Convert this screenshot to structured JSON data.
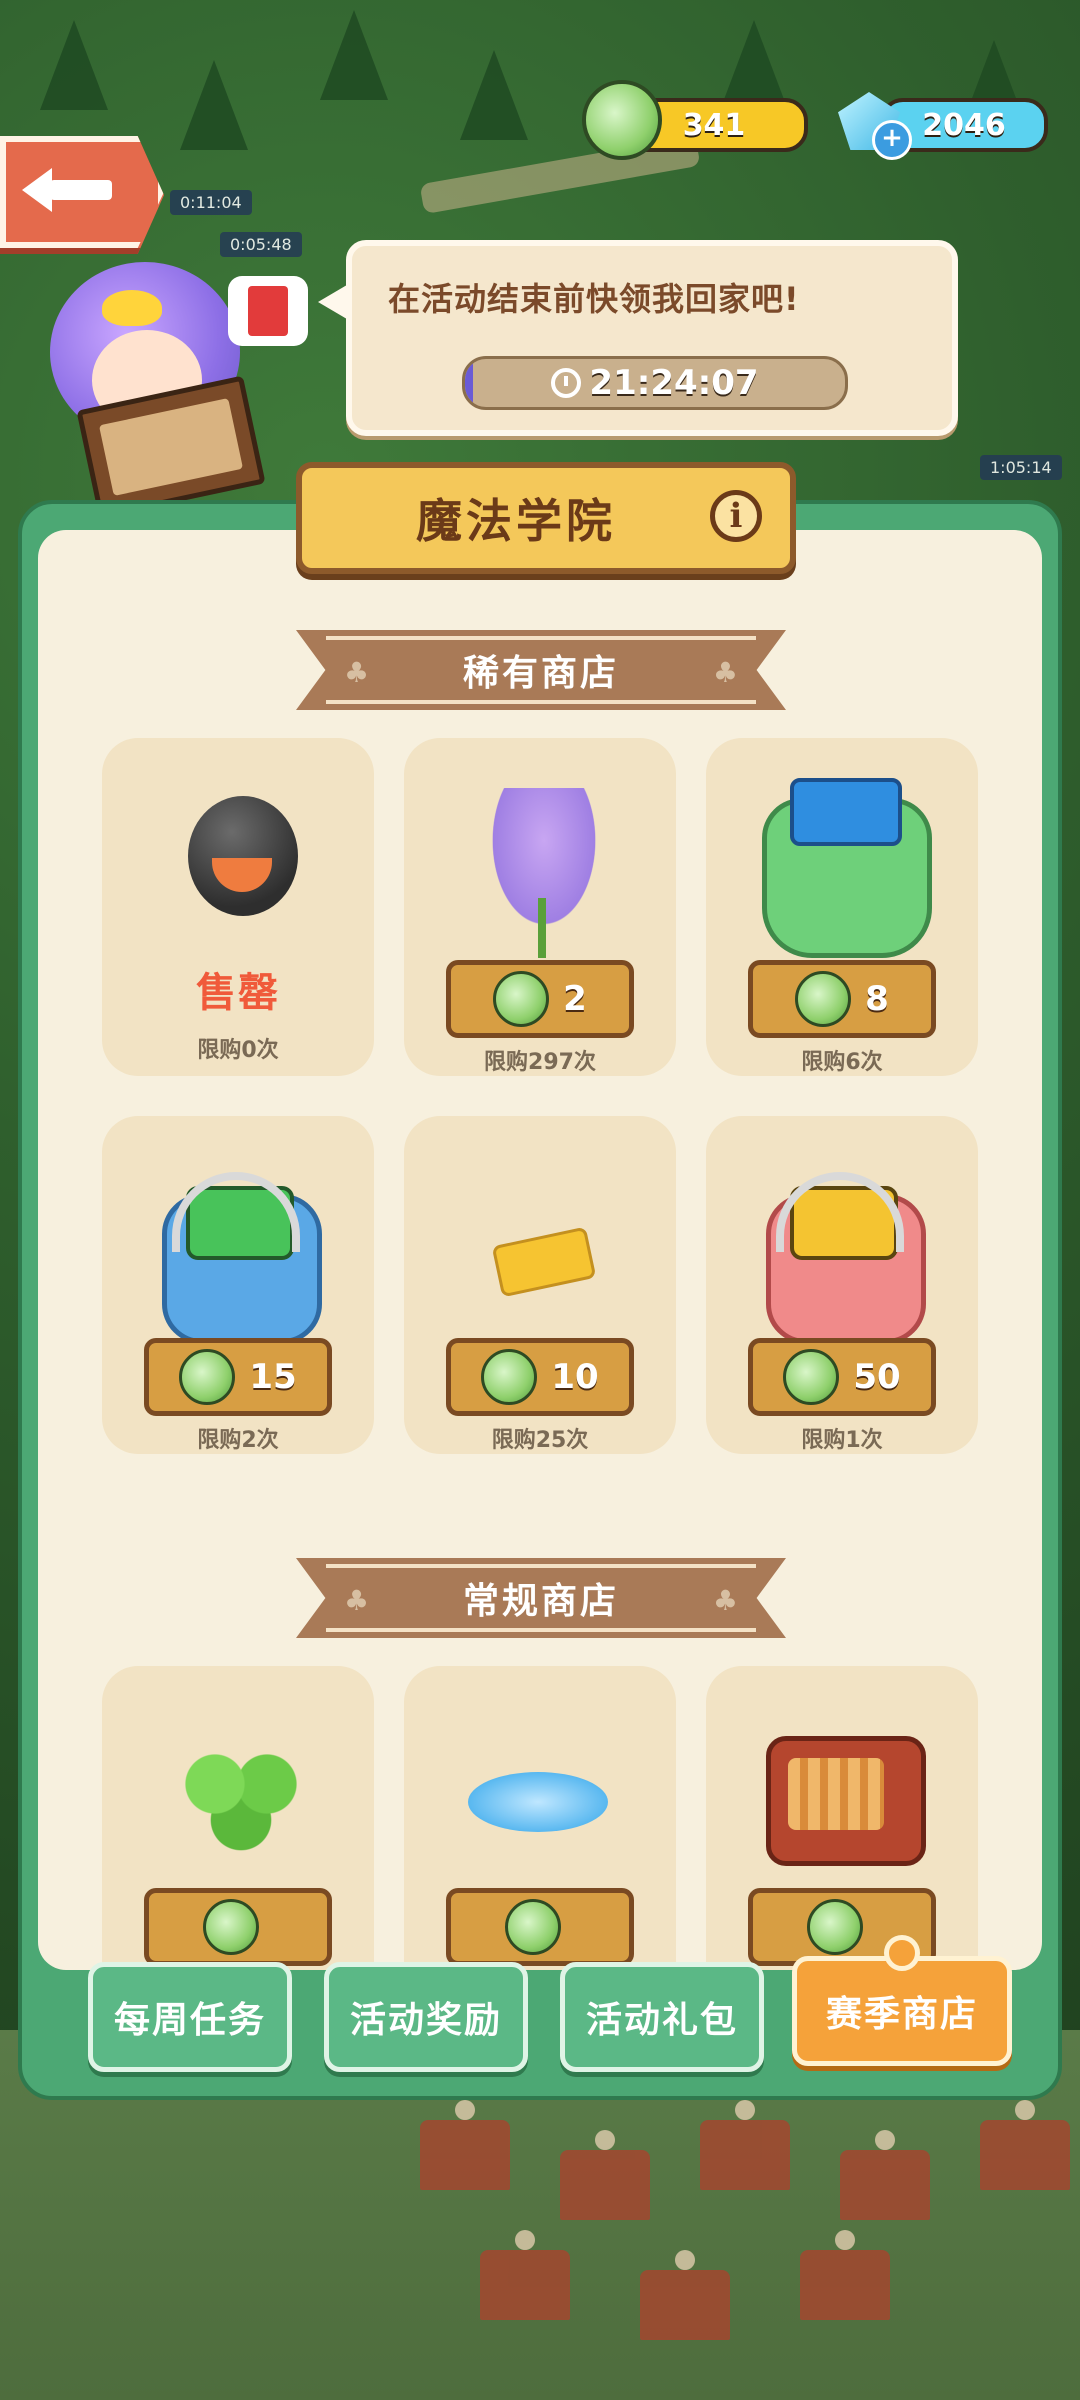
{
  "currency": {
    "leaf_amount": "341",
    "gem_amount": "2046",
    "leaf_icon": "leaf-coin-icon",
    "gem_icon": "diamond-icon"
  },
  "header": {
    "back_icon": "back-arrow-icon"
  },
  "npc": {
    "speech": "在活动结束前快领我回家吧!",
    "timer": "21:24:07",
    "timer_progress": 0.02
  },
  "panel": {
    "title": "魔法学院",
    "info_icon": "info-icon"
  },
  "rare_shop": {
    "title": "稀有商店",
    "items": [
      {
        "art": "crow-pet",
        "status": "售罄",
        "limit": "限购0次"
      },
      {
        "art": "lavender-flower",
        "price": "2",
        "limit": "限购297次"
      },
      {
        "art": "mystery-bag-green",
        "price": "8",
        "limit": "限购6次"
      },
      {
        "art": "robot-bag-blue",
        "price": "15",
        "limit": "限购2次"
      },
      {
        "art": "golden-ticket",
        "price": "10",
        "limit": "限购25次"
      },
      {
        "art": "robot-bag-pink",
        "price": "50",
        "limit": "限购1次"
      }
    ]
  },
  "regular_shop": {
    "title": "常规商店",
    "items": [
      {
        "art": "green-leaves"
      },
      {
        "art": "water-puddle"
      },
      {
        "art": "red-radio"
      }
    ]
  },
  "tabs": [
    {
      "label": "每周任务",
      "active": false
    },
    {
      "label": "活动奖励",
      "active": false
    },
    {
      "label": "活动礼包",
      "active": false
    },
    {
      "label": "赛季商店",
      "active": true
    }
  ],
  "colors": {
    "panel_green": "#4ca874",
    "accent_orange": "#f5a23a",
    "sold_red": "#f05a3a"
  }
}
